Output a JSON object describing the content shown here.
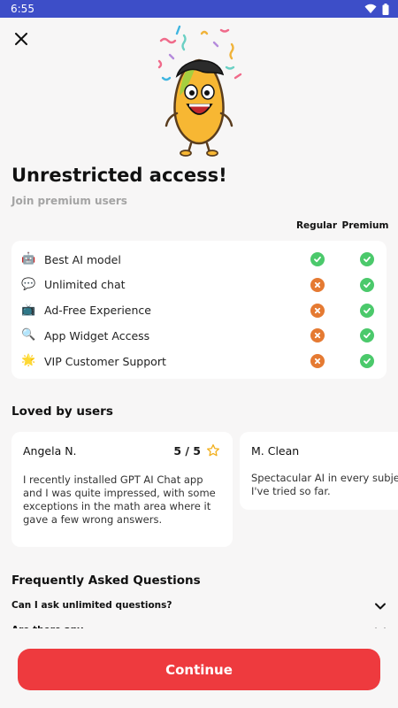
{
  "status_bar": {
    "time": "6:55",
    "icons": [
      "wifi-icon",
      "battery-icon"
    ]
  },
  "header": {
    "close_icon": "close-icon"
  },
  "hero": {
    "title": "Unrestricted access!",
    "subtitle": "Join premium users"
  },
  "comparison": {
    "columns": [
      "Regular",
      "Premium"
    ],
    "rows": [
      {
        "icon": "robot-icon",
        "emoji": "🤖",
        "label": "Best AI model",
        "regular": true,
        "premium": true
      },
      {
        "icon": "chat-icon",
        "emoji": "💬",
        "label": "Unlimited chat",
        "regular": false,
        "premium": true
      },
      {
        "icon": "tv-icon",
        "emoji": "📺",
        "label": "Ad-Free Experience",
        "regular": false,
        "premium": true
      },
      {
        "icon": "magnifier-icon",
        "emoji": "🔍",
        "label": "App Widget Access",
        "regular": false,
        "premium": true
      },
      {
        "icon": "star-burst-icon",
        "emoji": "🌟",
        "label": "VIP Customer Support",
        "regular": false,
        "premium": true
      }
    ],
    "colors": {
      "yes": "#4bc96b",
      "no": "#e57a32"
    }
  },
  "reviews": {
    "title": "Loved by users",
    "items": [
      {
        "name": "Angela N.",
        "rating": "5 / 5",
        "text": "I recently installed GPT AI Chat app and I was quite impressed, with some exceptions in the math area where it gave a few wrong answers."
      },
      {
        "name": "M. Clean",
        "text": "Spectacular AI in every subject I've tried so far."
      }
    ]
  },
  "faq": {
    "title": "Frequently Asked Questions",
    "questions": [
      "Can I ask unlimited questions?",
      "Are there any ..."
    ]
  },
  "cta": {
    "label": "Continue",
    "color": "#ee3a3e"
  }
}
